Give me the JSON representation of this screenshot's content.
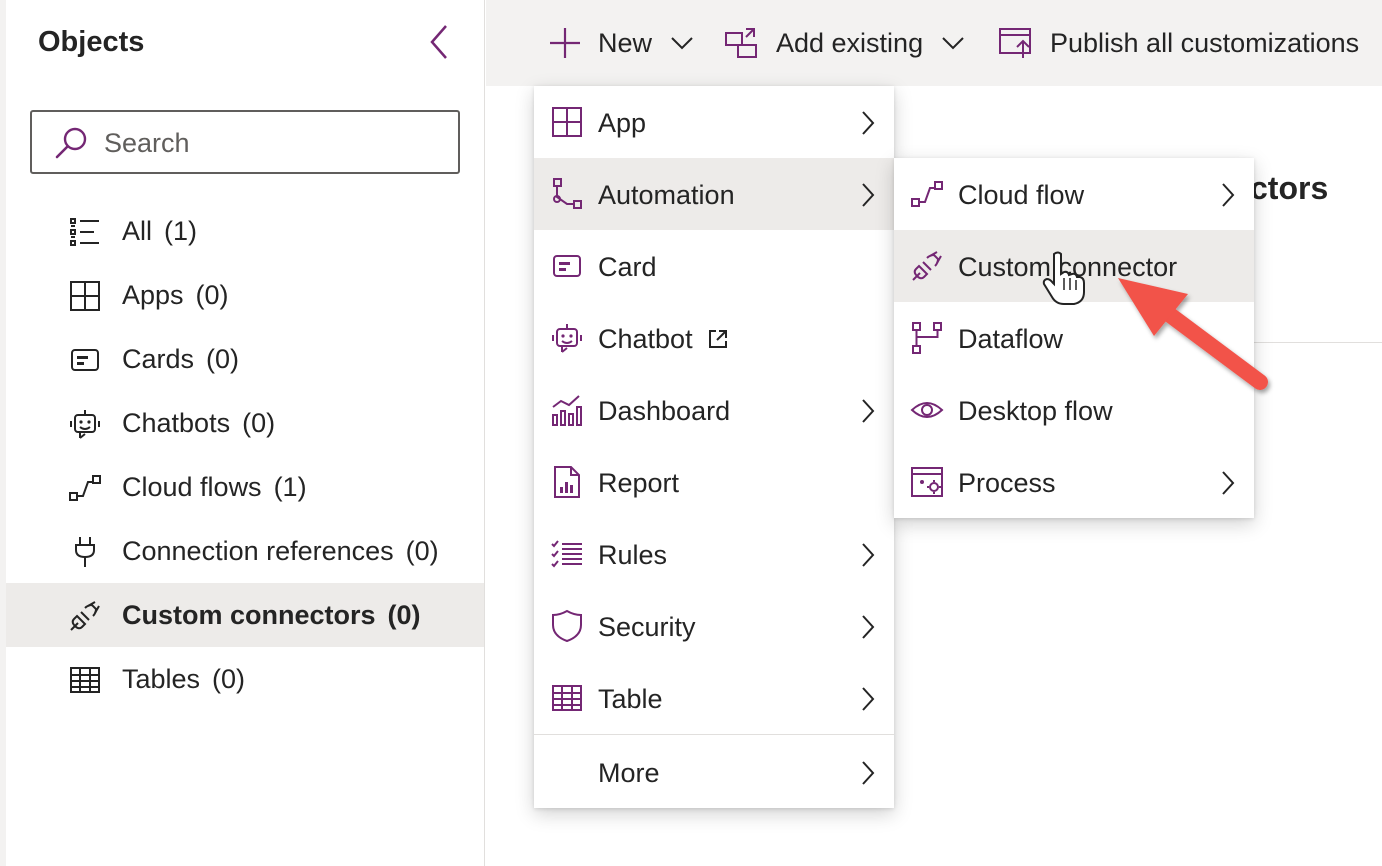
{
  "left_panel": {
    "title": "Objects",
    "search_placeholder": "Search",
    "items": [
      {
        "label": "All",
        "count": "(1)",
        "icon": "list-icon"
      },
      {
        "label": "Apps",
        "count": "(0)",
        "icon": "apps-icon"
      },
      {
        "label": "Cards",
        "count": "(0)",
        "icon": "card-icon"
      },
      {
        "label": "Chatbots",
        "count": "(0)",
        "icon": "chatbot-icon"
      },
      {
        "label": "Cloud flows",
        "count": "(1)",
        "icon": "cloud-flow-icon"
      },
      {
        "label": "Connection references",
        "count": "(0)",
        "icon": "plug-icon"
      },
      {
        "label": "Custom connectors",
        "count": "(0)",
        "icon": "connector-icon",
        "selected": true
      },
      {
        "label": "Tables",
        "count": "(0)",
        "icon": "table-icon"
      }
    ]
  },
  "command_bar": {
    "new_label": "New",
    "add_existing_label": "Add existing",
    "publish_label": "Publish all customizations"
  },
  "background": {
    "heading_fragment": "ctors"
  },
  "new_menu": {
    "items": [
      {
        "label": "App",
        "has_submenu": true
      },
      {
        "label": "Automation",
        "has_submenu": true,
        "highlighted": true
      },
      {
        "label": "Card",
        "has_submenu": false
      },
      {
        "label": "Chatbot",
        "has_submenu": false,
        "external": true
      },
      {
        "label": "Dashboard",
        "has_submenu": true
      },
      {
        "label": "Report",
        "has_submenu": false
      },
      {
        "label": "Rules",
        "has_submenu": true
      },
      {
        "label": "Security",
        "has_submenu": true
      },
      {
        "label": "Table",
        "has_submenu": true
      },
      {
        "label": "More",
        "has_submenu": true
      }
    ]
  },
  "automation_submenu": {
    "items": [
      {
        "label": "Cloud flow",
        "has_submenu": true
      },
      {
        "label": "Custom connector",
        "has_submenu": false,
        "highlighted": true
      },
      {
        "label": "Dataflow",
        "has_submenu": false
      },
      {
        "label": "Desktop flow",
        "has_submenu": false
      },
      {
        "label": "Process",
        "has_submenu": true
      }
    ]
  },
  "colors": {
    "accent_purple": "#742774",
    "highlight_bg": "#edebe9",
    "command_bar_bg": "#f3f2f1",
    "annotation_arrow": "#f2524a"
  }
}
